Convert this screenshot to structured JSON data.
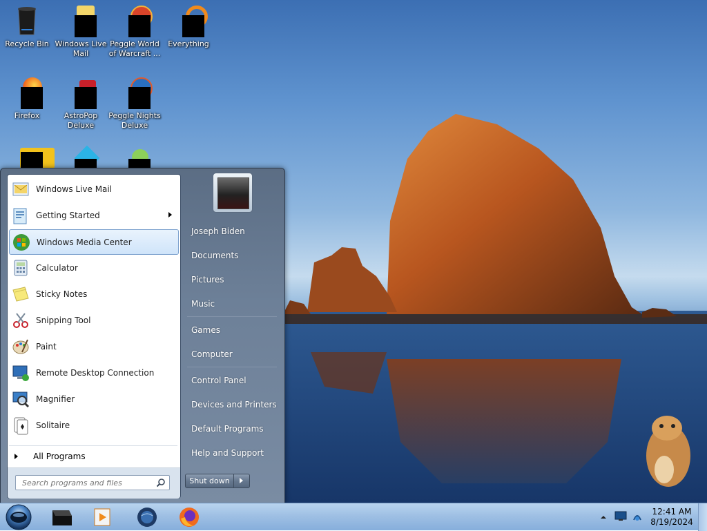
{
  "desktop_icons": [
    {
      "label": "Recycle Bin",
      "icon": "recycle-bin-icon"
    },
    {
      "label": "Windows Live Mail",
      "icon": "mail-icon"
    },
    {
      "label": "Peggle World of Warcraft ...",
      "icon": "peggle-wow-icon"
    },
    {
      "label": "Everything",
      "icon": "search-everything-icon"
    },
    {
      "label": "Firefox",
      "icon": "firefox-icon"
    },
    {
      "label": "AstroPop Deluxe",
      "icon": "astropop-icon"
    },
    {
      "label": "Peggle Nights Deluxe",
      "icon": "peggle-nights-icon"
    }
  ],
  "start_menu": {
    "programs": [
      {
        "label": "Windows Live Mail",
        "icon": "mail-icon"
      },
      {
        "label": "Getting Started",
        "icon": "getting-started-icon",
        "has_submenu": true
      },
      {
        "label": "Windows Media Center",
        "icon": "media-center-icon",
        "highlighted": true
      },
      {
        "label": "Calculator",
        "icon": "calculator-icon"
      },
      {
        "label": "Sticky Notes",
        "icon": "sticky-notes-icon"
      },
      {
        "label": "Snipping Tool",
        "icon": "scissors-icon"
      },
      {
        "label": "Paint",
        "icon": "paint-palette-icon"
      },
      {
        "label": "Remote Desktop Connection",
        "icon": "remote-desktop-icon"
      },
      {
        "label": "Magnifier",
        "icon": "magnifier-icon"
      },
      {
        "label": "Solitaire",
        "icon": "cards-icon"
      }
    ],
    "all_programs_label": "All Programs",
    "search_placeholder": "Search programs and files",
    "right_items": [
      "Joseph Biden",
      "Documents",
      "Pictures",
      "Music",
      "Games",
      "Computer",
      "Control Panel",
      "Devices and Printers",
      "Default Programs",
      "Help and Support"
    ],
    "shutdown_label": "Shut down"
  },
  "taskbar": {
    "pinned": [
      "black-app-icon",
      "media-player-icon",
      "browser-globe-icon",
      "firefox-icon"
    ],
    "tray_icons": [
      "show-hidden-icons-arrow",
      "display-icon",
      "network-icon"
    ],
    "clock_time": "12:41 AM",
    "clock_date": "8/19/2024"
  },
  "colors": {
    "accent": "#cfe4fa",
    "start_right_pane": "#6d8098",
    "taskbar": "#9fc0e4"
  }
}
